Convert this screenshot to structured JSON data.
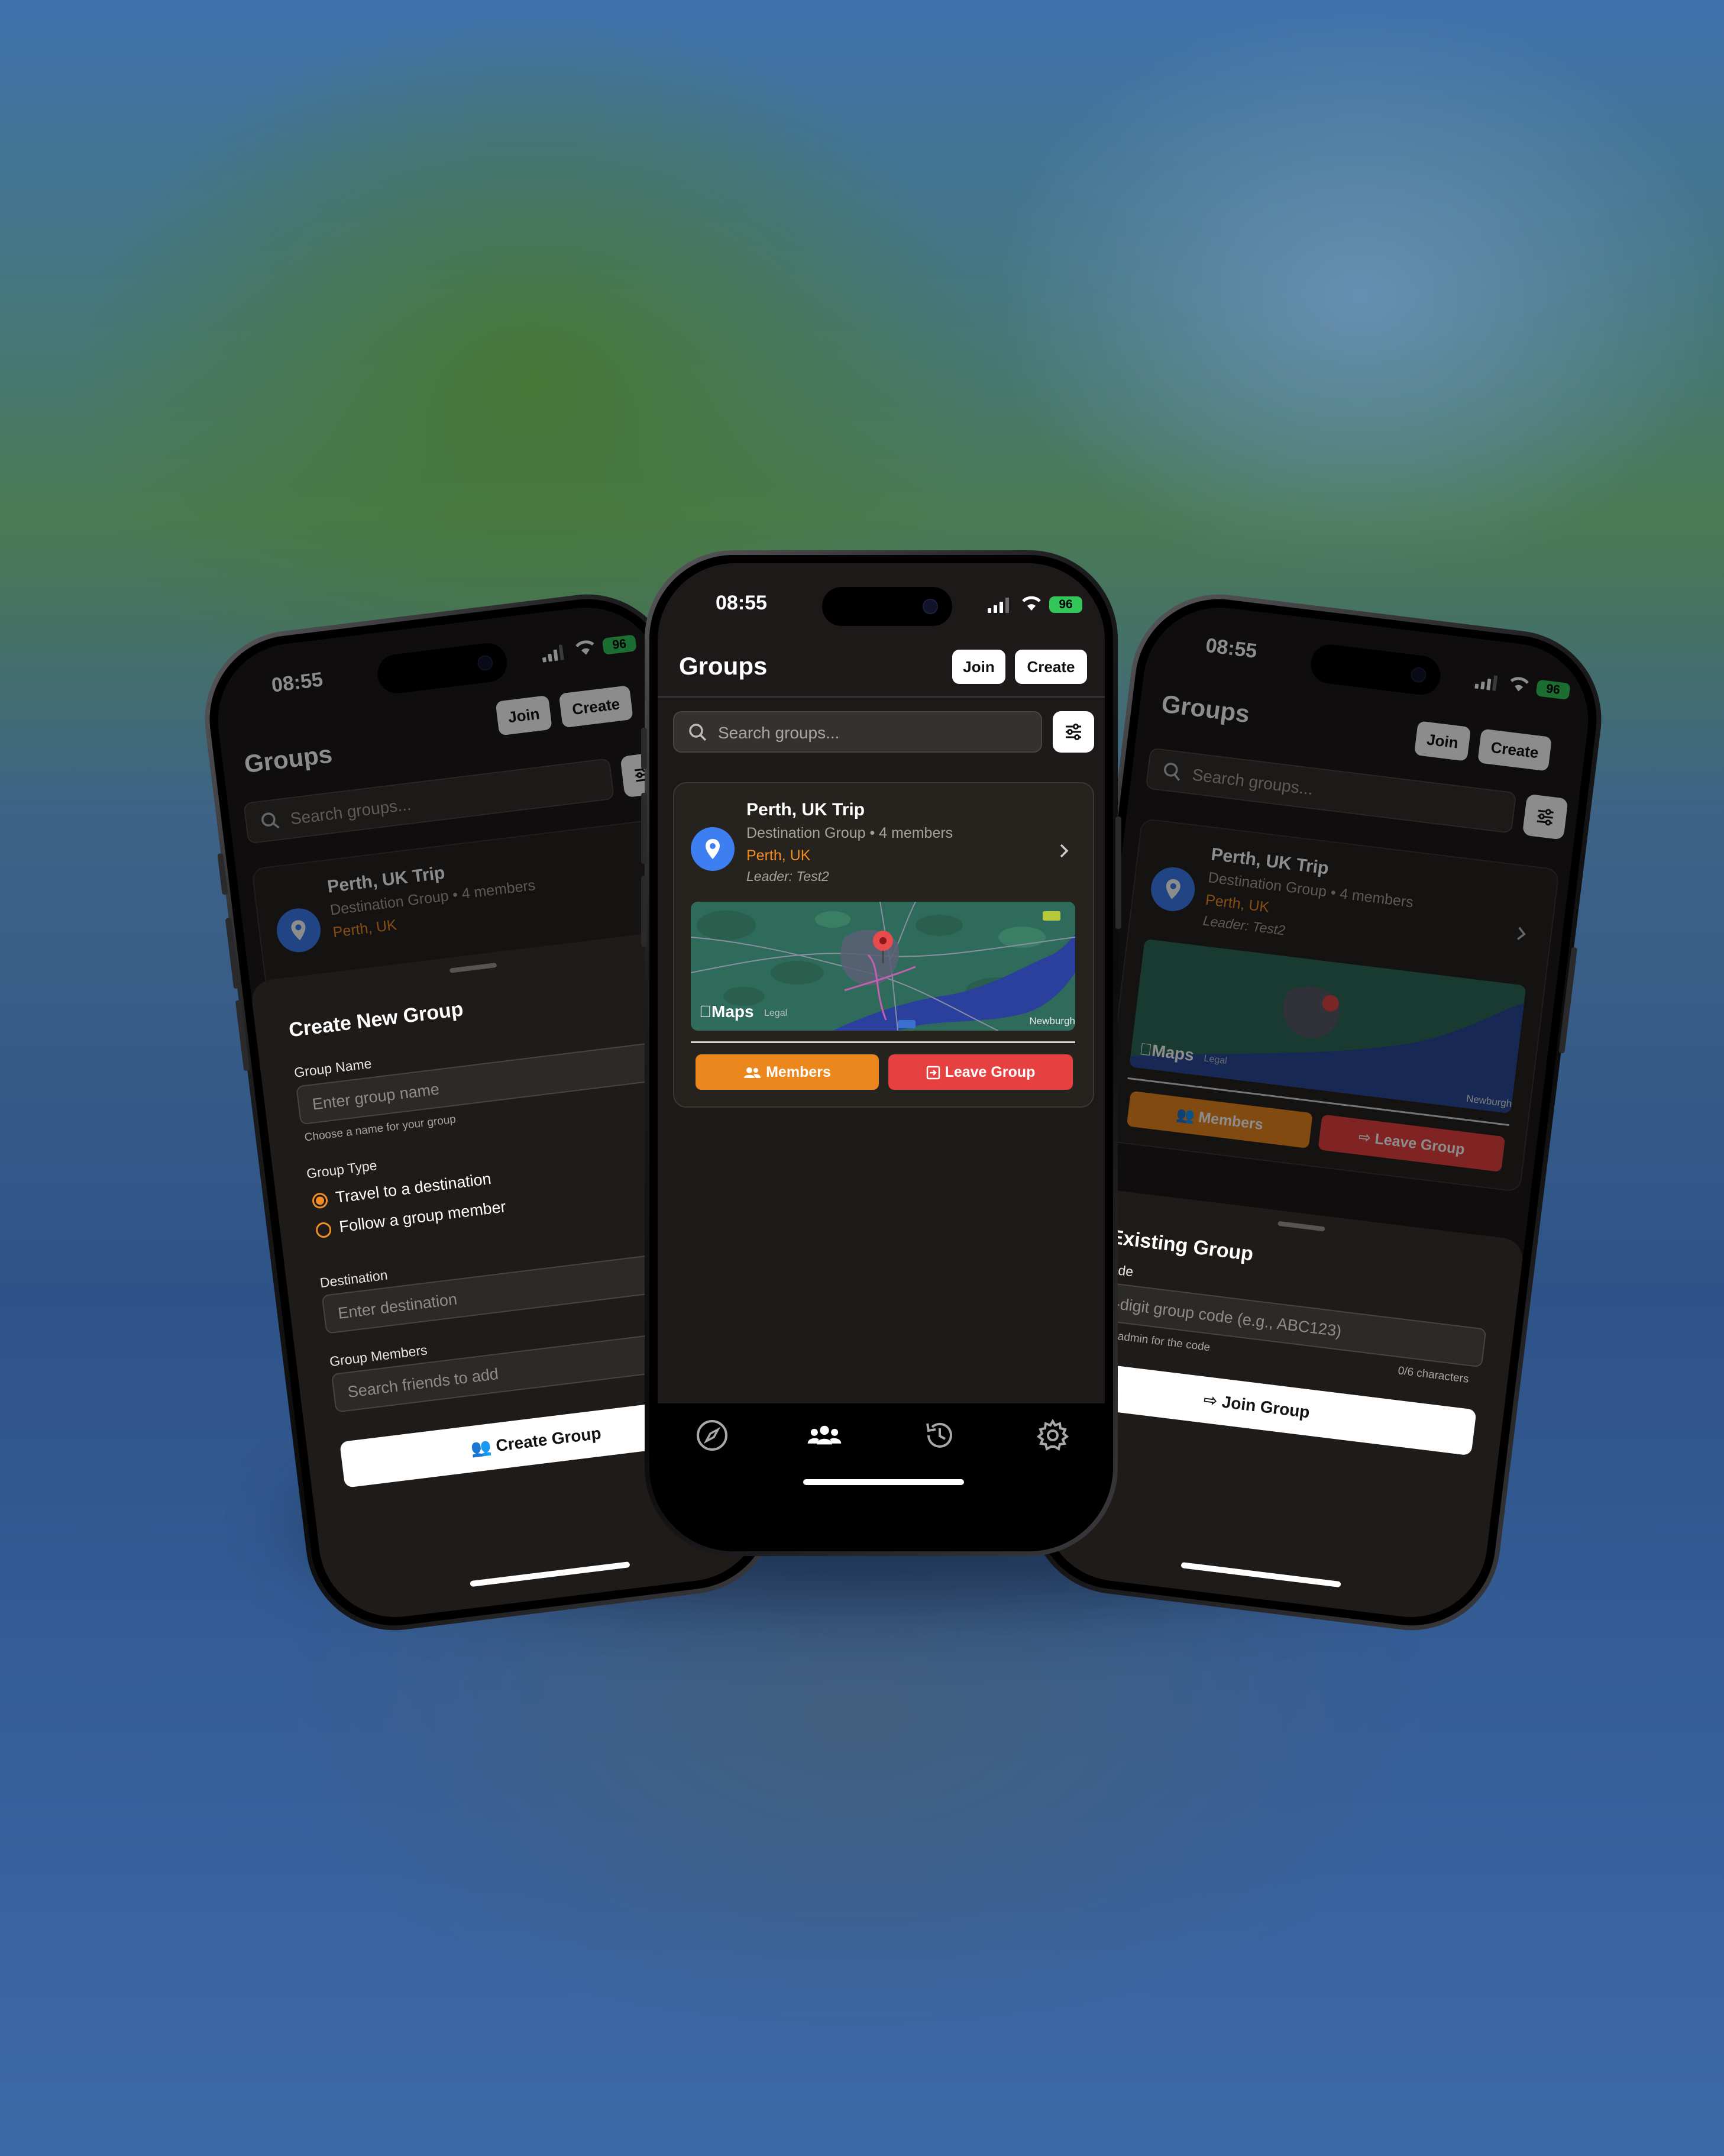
{
  "status": {
    "time": "08:55",
    "battery": "96"
  },
  "header": {
    "title": "Groups",
    "join_label": "Join",
    "create_label": "Create"
  },
  "search": {
    "placeholder": "Search groups..."
  },
  "group": {
    "title": "Perth, UK Trip",
    "subtitle": "Destination Group • 4 members",
    "location": "Perth, UK",
    "leader": "Leader: Test2",
    "map_brand": "Maps",
    "map_legal": "Legal",
    "map_place": "Newburgh",
    "members_label": "Members",
    "leave_label": "Leave Group"
  },
  "tabs": [
    "explore-icon",
    "groups-icon",
    "history-icon",
    "settings-icon"
  ],
  "create_sheet": {
    "title": "Create New Group",
    "name_label": "Group Name",
    "name_placeholder": "Enter group name",
    "name_hint": "Choose a name for your group",
    "type_label": "Group Type",
    "type_options": [
      "Travel to a destination",
      "Follow a group member"
    ],
    "selected_type": "Travel to a destination",
    "destination_label": "Destination",
    "destination_placeholder": "Enter destination",
    "members_label": "Group Members",
    "members_placeholder": "Search friends to add",
    "submit_label": "Create Group"
  },
  "join_sheet": {
    "title": "Join Existing Group",
    "code_label": "Group Code",
    "code_placeholder": "Enter 6-digit group code (e.g., ABC123)",
    "code_hint": "Ask the group admin for the code",
    "counter": "0/6 characters",
    "submit_label": "Join Group"
  },
  "colors": {
    "accent_orange": "#ec871e",
    "danger_red": "#e74040",
    "pin_blue": "#3d7ff0",
    "battery_green": "#33c759"
  }
}
